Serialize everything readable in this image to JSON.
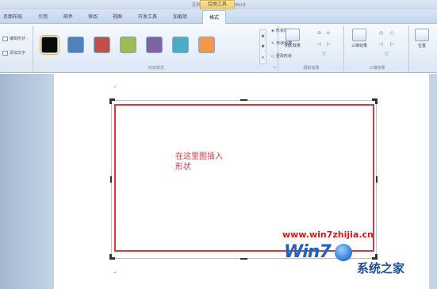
{
  "window": {
    "title": "文档 1 - Microsoft Word",
    "context_tools_label": "绘图工具"
  },
  "tabs": [
    {
      "label": "页面布局"
    },
    {
      "label": "引用"
    },
    {
      "label": "邮件"
    },
    {
      "label": "审阅"
    },
    {
      "label": "视图"
    },
    {
      "label": "开发工具"
    },
    {
      "label": "加载项"
    },
    {
      "label": "格式",
      "active": true
    }
  ],
  "ribbon": {
    "insert_shapes": {
      "edit_shape": "编辑形状 ·",
      "add_text": "添加文字"
    },
    "shape_styles": {
      "label": "形状样式",
      "swatches": [
        "#0a0a0a",
        "#4f81bd",
        "#c0504d",
        "#9bbb59",
        "#8064a2",
        "#4bacc6",
        "#f79646"
      ],
      "shape_fill": "形状填充 ·",
      "shape_outline": "形状轮廓 ·",
      "change_shape": "更改形状 ·"
    },
    "shadow_effects": {
      "label": "阴影效果",
      "button": "阴影效果"
    },
    "threed_effects": {
      "label": "三维效果",
      "button": "三维效果"
    },
    "arrange": {
      "position": "位置"
    }
  },
  "document": {
    "shape_text": "在这里图插入形状"
  },
  "watermark": {
    "url": "www.win7zhijia.cn",
    "logo": "Win7",
    "cn": "系统之家"
  },
  "colors": {
    "accent": "#e5323b",
    "ribbon": "#dbe7f5"
  }
}
